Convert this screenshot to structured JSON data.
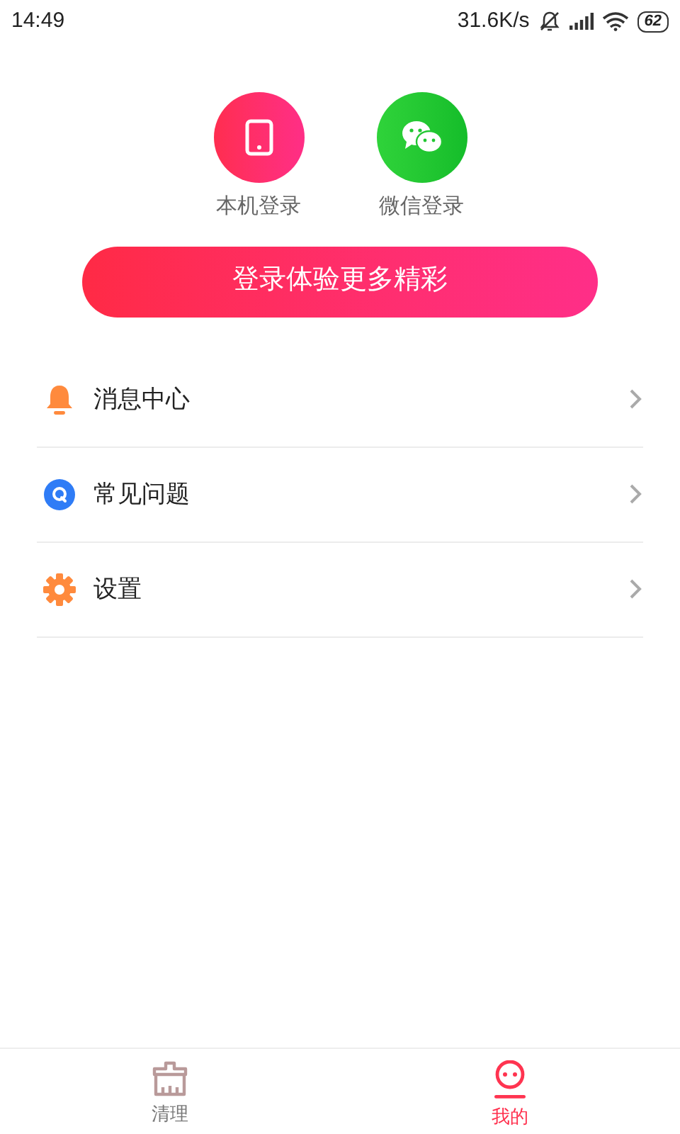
{
  "status_bar": {
    "time": "14:49",
    "speed": "31.6K/s",
    "battery": "62"
  },
  "login_options": [
    {
      "kind": "phone",
      "label": "本机登录"
    },
    {
      "kind": "wechat",
      "label": "微信登录"
    }
  ],
  "login_button": "登录体验更多精彩",
  "menu": [
    {
      "kind": "bell",
      "label": "消息中心"
    },
    {
      "kind": "faq",
      "label": "常见问题"
    },
    {
      "kind": "gear",
      "label": "设置"
    }
  ],
  "bottom_nav": [
    {
      "kind": "clean",
      "label": "清理",
      "selected": false
    },
    {
      "kind": "me",
      "label": "我的",
      "selected": true
    }
  ]
}
